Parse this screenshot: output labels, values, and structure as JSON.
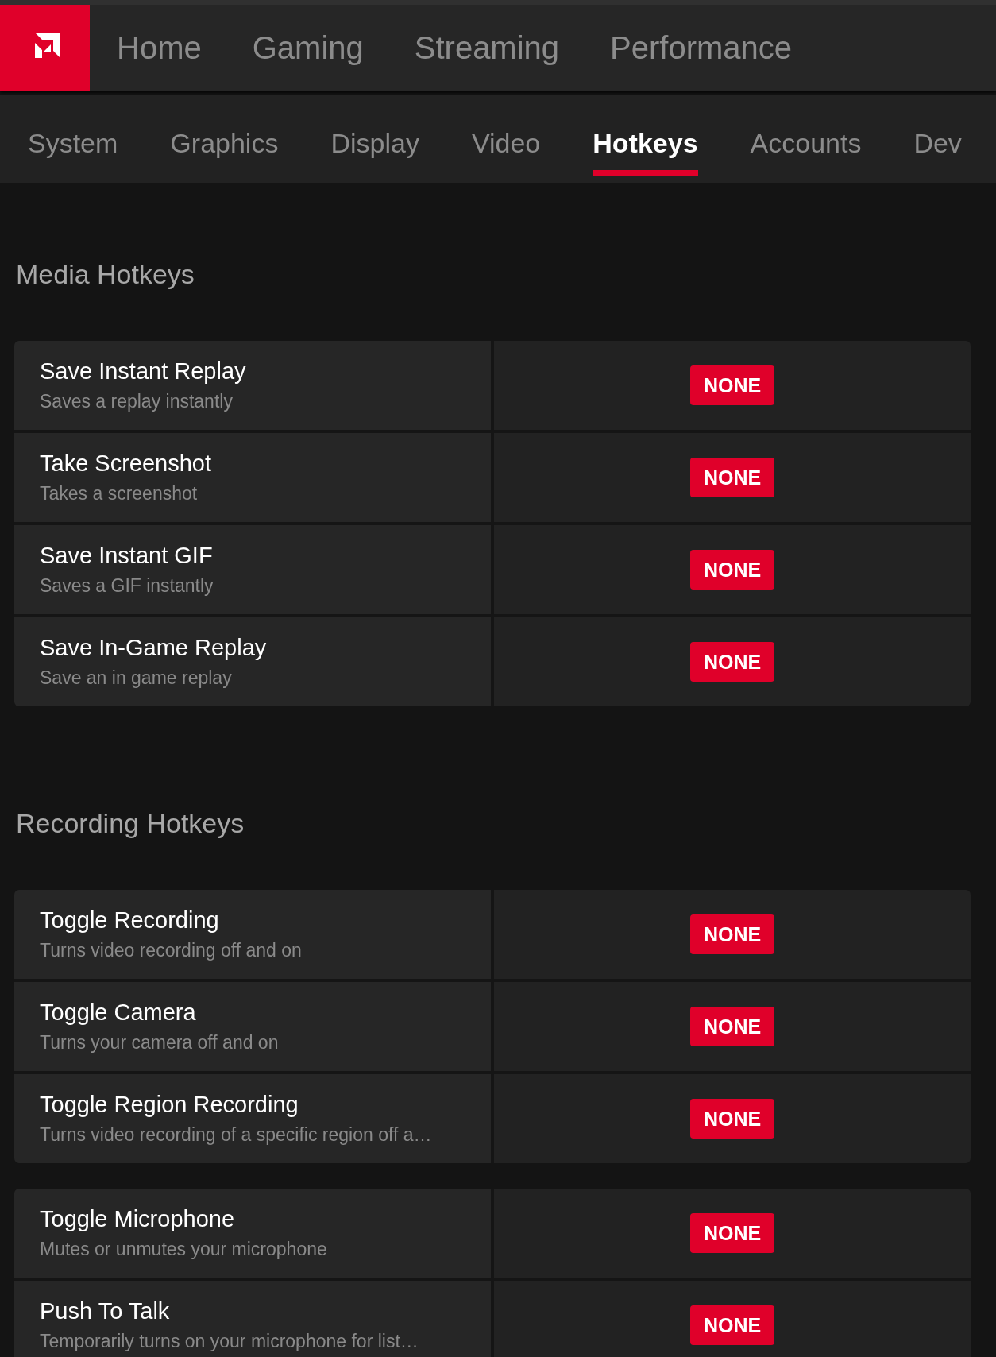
{
  "top_nav": [
    {
      "label": "Home"
    },
    {
      "label": "Gaming"
    },
    {
      "label": "Streaming"
    },
    {
      "label": "Performance"
    }
  ],
  "tabs": [
    {
      "label": "System",
      "selected": false
    },
    {
      "label": "Graphics",
      "selected": false
    },
    {
      "label": "Display",
      "selected": false
    },
    {
      "label": "Video",
      "selected": false
    },
    {
      "label": "Hotkeys",
      "selected": true
    },
    {
      "label": "Accounts",
      "selected": false
    },
    {
      "label": "Dev",
      "selected": false
    }
  ],
  "sections": [
    {
      "title": "Media Hotkeys",
      "groups": [
        {
          "rows": [
            {
              "name": "Save Instant Replay",
              "description": "Saves a replay instantly",
              "hotkey": "NONE"
            },
            {
              "name": "Take Screenshot",
              "description": "Takes a screenshot",
              "hotkey": "NONE"
            },
            {
              "name": "Save Instant GIF",
              "description": "Saves a GIF instantly",
              "hotkey": "NONE"
            },
            {
              "name": "Save In-Game Replay",
              "description": "Save an in game replay",
              "hotkey": "NONE"
            }
          ]
        }
      ]
    },
    {
      "title": "Recording Hotkeys",
      "groups": [
        {
          "rows": [
            {
              "name": "Toggle Recording",
              "description": "Turns video recording off and on",
              "hotkey": "NONE"
            },
            {
              "name": "Toggle Camera",
              "description": "Turns your camera off and on",
              "hotkey": "NONE"
            },
            {
              "name": "Toggle Region Recording",
              "description": "Turns video recording of a specific region off a…",
              "hotkey": "NONE"
            }
          ]
        },
        {
          "rows": [
            {
              "name": "Toggle Microphone",
              "description": "Mutes or unmutes your microphone",
              "hotkey": "NONE"
            },
            {
              "name": "Push To Talk",
              "description": "Temporarily turns on your microphone for list…",
              "hotkey": "NONE"
            }
          ]
        }
      ]
    }
  ]
}
